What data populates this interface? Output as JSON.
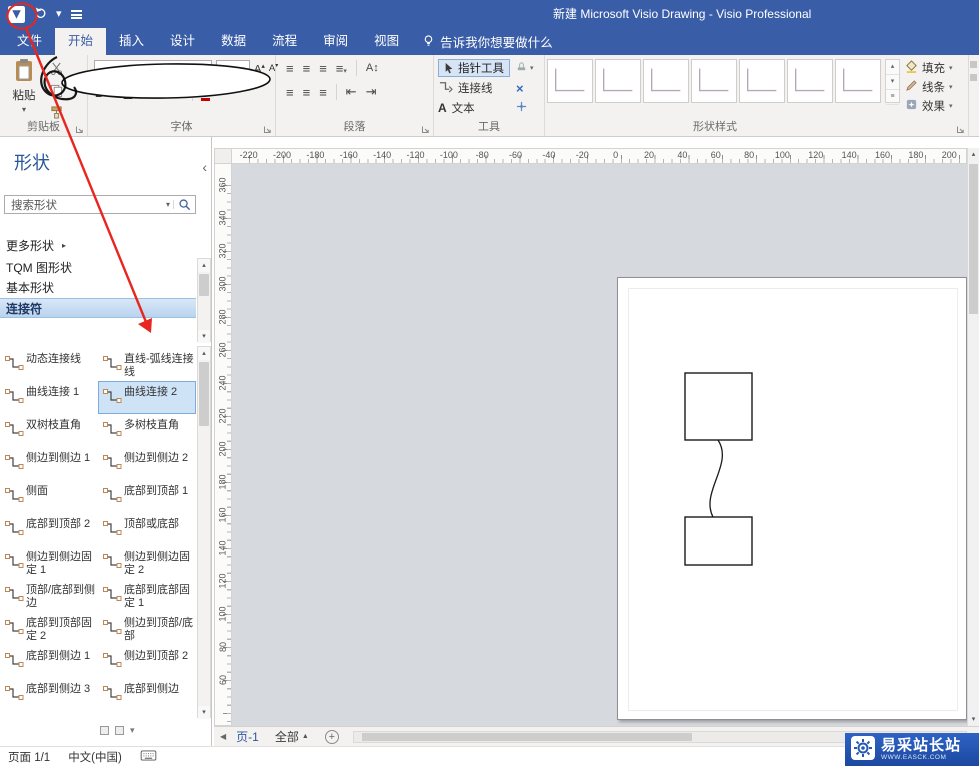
{
  "colors": {
    "accent_blue": "#3a5da8",
    "ribbon_bg": "#f3f2f1",
    "selection_blue": "#cfe3f7",
    "annotation_red": "#e8251f",
    "watermark_blue": "#1c48a0"
  },
  "title_bar": {
    "title": "新建 Microsoft Visio Drawing - Visio Professional"
  },
  "ribbon_tabs": {
    "tabs": [
      {
        "label": "文件",
        "file": true
      },
      {
        "label": "开始",
        "active": true
      },
      {
        "label": "插入"
      },
      {
        "label": "设计"
      },
      {
        "label": "数据"
      },
      {
        "label": "流程"
      },
      {
        "label": "审阅"
      },
      {
        "label": "视图"
      }
    ],
    "tell_me": "告诉我你想要做什么"
  },
  "ribbon": {
    "clipboard": {
      "label": "剪贴板",
      "paste": "粘贴"
    },
    "font": {
      "label": "字体",
      "bold": "B",
      "italic": "I",
      "underline": "U",
      "strike": "abc",
      "case": "Aa",
      "color": "A",
      "grow": "A",
      "shrink": "A"
    },
    "paragraph": {
      "label": "段落"
    },
    "tools": {
      "label": "工具",
      "pointer": "指针工具",
      "connector": "连接线",
      "text": "文本"
    },
    "shape_styles": {
      "label": "形状样式",
      "fill": "填充",
      "line": "线条",
      "effects": "效果"
    }
  },
  "shapes_panel": {
    "title": "形状",
    "search_placeholder": "搜索形状",
    "more_shapes": "更多形状",
    "stencil_tabs": [
      {
        "label": "TQM 图形状"
      },
      {
        "label": "基本形状"
      },
      {
        "label": "连接符",
        "selected": true
      }
    ],
    "items": [
      {
        "label": "动态连接线"
      },
      {
        "label": "直线-弧线连接线"
      },
      {
        "label": "曲线连接 1"
      },
      {
        "label": "曲线连接 2",
        "selected": true
      },
      {
        "label": "双树枝直角"
      },
      {
        "label": "多树枝直角"
      },
      {
        "label": "侧边到侧边 1"
      },
      {
        "label": "侧边到侧边 2"
      },
      {
        "label": "侧面"
      },
      {
        "label": "底部到顶部 1"
      },
      {
        "label": "底部到顶部 2"
      },
      {
        "label": "顶部或底部"
      },
      {
        "label": "侧边到侧边固定 1"
      },
      {
        "label": "侧边到侧边固定 2"
      },
      {
        "label": "顶部/底部到侧边"
      },
      {
        "label": "底部到底部固定 1"
      },
      {
        "label": "底部到顶部固定 2"
      },
      {
        "label": "侧边到顶部/底部"
      },
      {
        "label": "底部到侧边 1"
      },
      {
        "label": "侧边到顶部 2"
      },
      {
        "label": "底部到侧边 3"
      },
      {
        "label": "底部到侧边"
      }
    ]
  },
  "rulers": {
    "horizontal": [
      "-220",
      "-200",
      "-180",
      "-160",
      "-140",
      "-120",
      "-100",
      "-80",
      "-60",
      "-40",
      "-20",
      "0",
      "20",
      "40",
      "60",
      "80",
      "100",
      "120",
      "140",
      "160",
      "180",
      "200"
    ],
    "vertical": [
      "360",
      "340",
      "320",
      "300",
      "280",
      "260",
      "240",
      "220",
      "200",
      "180",
      "160",
      "140",
      "120",
      "100",
      "80",
      "60"
    ]
  },
  "page_tabs": {
    "page1": "页-1",
    "all": "全部"
  },
  "status_bar": {
    "page_info": "页面 1/1",
    "language": "中文(中国)"
  },
  "watermark": {
    "text": "易采站长站",
    "subtext": "WWW.EASCK.COM"
  }
}
